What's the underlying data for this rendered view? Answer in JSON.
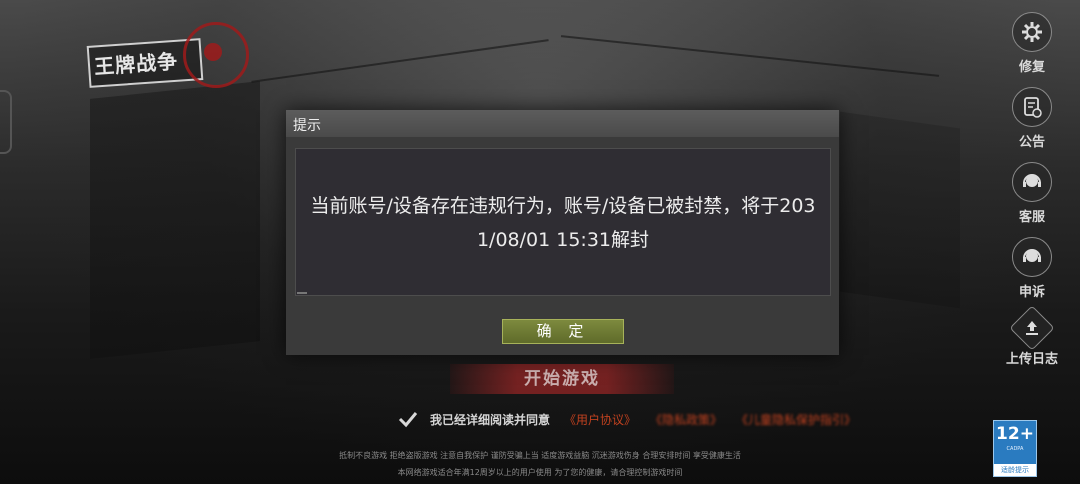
{
  "logo": {
    "text": "王牌战争"
  },
  "sidebar": {
    "items": [
      {
        "label": "修复",
        "icon": "gear-icon"
      },
      {
        "label": "公告",
        "icon": "notice-icon"
      },
      {
        "label": "客服",
        "icon": "headset-icon"
      },
      {
        "label": "申诉",
        "icon": "headset-icon"
      },
      {
        "label": "上传日志",
        "icon": "upload-icon"
      }
    ]
  },
  "dialog": {
    "title": "提示",
    "message_line1": "当前账号/设备存在违规行为，账号/设备已被封禁，将于203",
    "message_line2": "1/08/01 15:31解封",
    "confirm_label": "确 定"
  },
  "start_button": {
    "label": "开始游戏"
  },
  "agreement": {
    "text": "我已经详细阅读并同意",
    "links": [
      "《用户协议》",
      "《隐私政策》",
      "《儿童隐私保护指引》"
    ]
  },
  "footer": {
    "line1": "抵制不良游戏 拒绝盗版游戏 注意自我保护 谨防受骗上当 适度游戏益脑 沉迷游戏伤身 合理安排时间 享受健康生活",
    "line2": "本网络游戏适合年满12周岁以上的用户使用   为了您的健康，请合理控制游戏时间"
  },
  "age_rating": {
    "number": "12+",
    "org": "CADPA",
    "tip": "适龄提示"
  },
  "colors": {
    "accent_red": "#c0411f",
    "confirm_green": "#6f7b33",
    "age_blue": "#2a7bc0"
  }
}
